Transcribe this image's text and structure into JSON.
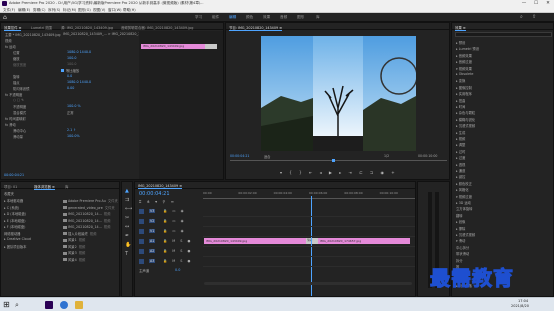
{
  "window": {
    "title": "Adobe Premiere Pro 2020 - D:\\用户\\5G\\学习资料\\最新版Premiere Pro 2020 从新手到高手 (微视频版) \\素材\\第4章\\...",
    "min": "—",
    "max": "☐",
    "close": "✕"
  },
  "menu": [
    "文件(F)",
    "编辑(E)",
    "剪辑(C)",
    "序列(S)",
    "标记(M)",
    "图形(G)",
    "视图(V)",
    "窗口(W)",
    "帮助(H)"
  ],
  "workspace_tabs": [
    {
      "label": "学习",
      "active": false
    },
    {
      "label": "组件",
      "active": false
    },
    {
      "label": "编辑",
      "active": true
    },
    {
      "label": "颜色",
      "active": false
    },
    {
      "label": "效果",
      "active": false
    },
    {
      "label": "音频",
      "active": false
    },
    {
      "label": "图形",
      "active": false
    },
    {
      "label": "库",
      "active": false
    }
  ],
  "effect_controls": {
    "tabs": [
      "效果控件 ≡",
      "Lumetri 范围",
      "源: IMG_20210820_143409.jpg",
      "音频剪辑混合器: IMG_20210820_143409.jpg"
    ],
    "source_label": "主要 * IMG_20210820_143409.jpg",
    "clip_label": "IMG_20210820_143409_... > IMG_20210820_143409.jpg",
    "section_video": "视频",
    "effect_motion": "fx 运动",
    "prop_position": "位置",
    "position_values": "1080.0  1440.0",
    "prop_scale": "缩放",
    "scale_value": "100.0",
    "prop_scale_width": "缩放宽度",
    "scale_width_value": "100.0",
    "uniform_scale": "等比缩放",
    "prop_rotation": "旋转",
    "rotation_value": "0.0",
    "prop_anchor": "锚点",
    "anchor_values": "1080.0  1440.0",
    "prop_flicker": "防闪烁滤镜",
    "flicker_value": "0.00",
    "effect_opacity": "fx 不透明度",
    "prop_opacity": "不透明度",
    "opacity_value": "100.0 %",
    "blend_mode": "混合模式",
    "blend_value": "正常",
    "effect_time": "fx 时间重映射",
    "effect_slide": "fx 滑动",
    "slide_center": "滑动中心",
    "slide_center_value": "2.1 ↑",
    "slide_amount": "滑动量",
    "slide_amount_value": "100.0%",
    "timecode": "00:00:04:21",
    "mini_clip": "IMG_20210820_143409.jpg"
  },
  "program_monitor": {
    "tab": "节目: IMG_20210820_143409 ≡",
    "timecode_left": "00:00:04:21",
    "fit": "适合",
    "fraction": "1/2",
    "timecode_right": "00:00:10:00"
  },
  "effects_panel": {
    "tab": "效果 ≡",
    "items": [
      "▸ 预设",
      "▸ Lumetri 预设",
      "▸ 音频效果",
      "▸ 音频过渡",
      "▾ 视频效果",
      "  ▸ Obsolete",
      "  ▸ 变换",
      "  ▸ 图像控制",
      "  ▸ 实用程序",
      "  ▸ 扭曲",
      "  ▸ 时间",
      "  ▸ 杂色与颗粒",
      "  ▸ 模糊与锐化",
      "  ▸ 沉浸式视频",
      "  ▸ 生成",
      "  ▸ 视频",
      "  ▸ 调整",
      "  ▸ 过时",
      "  ▸ 过渡",
      "  ▸ 透视",
      "  ▸ 通道",
      "  ▸ 键控",
      "  ▸ 颜色校正",
      "  ▸ 风格化",
      "▾ 视频过渡",
      "  ▸ 3D 运动",
      "    立方体旋转",
      "    翻转",
      "  ▸ 划像",
      "  ▸ 擦除",
      "  ▸ 沉浸式视频",
      "  ▾ 滑动",
      "    中心拆分",
      "    带状滑动",
      "    拆分",
      "    推",
      "    滑动",
      "  ▸ 缩放",
      "  ▸ 页面剥落"
    ]
  },
  "project_panel": {
    "tabs": [
      "项目: 01",
      "媒体浏览器 ≡",
      "库"
    ],
    "favorites": "收藏夹",
    "tree": [
      "▸ 本地驱动器",
      "  ▸ C (系统)",
      "  ▸ D (本地磁盘)",
      "  ▸ E (本地磁盘)",
      "  ▸ F (本地磁盘)",
      "网络驱动器",
      "▸ Creative Cloud",
      "  ▸ 团队项目版本"
    ],
    "files": [
      {
        "name": "Adobe Premiere Pro Au",
        "type": "文件夹"
      },
      {
        "name": "generated_video_pre",
        "type": "文件夹"
      },
      {
        "name": "IMG_20210820_14...",
        "type": "视频"
      },
      {
        "name": "IMG_20210820_14...",
        "type": "视频"
      },
      {
        "name": "IMG_20210820_14...",
        "type": "视频"
      },
      {
        "name": "插入片段最终",
        "type": "视频"
      },
      {
        "name": "风景1",
        "type": "视频"
      },
      {
        "name": "风景2",
        "type": "视频"
      },
      {
        "name": "风景3",
        "type": "视频"
      },
      {
        "name": "风景4",
        "type": "视频"
      }
    ]
  },
  "timeline": {
    "tab": "IMG_20210820_143409 ≡",
    "timecode": "00:00:04:21",
    "ruler": [
      "00:00",
      "00:00:02:00",
      "00:00:04:00",
      "00:00:06:00",
      "00:00:08:00",
      "00:00:10:00"
    ],
    "tracks": [
      {
        "name": "V3"
      },
      {
        "name": "V2"
      },
      {
        "name": "V1"
      },
      {
        "name": "A1"
      },
      {
        "name": "A2"
      },
      {
        "name": "A3"
      }
    ],
    "master": "主声道",
    "master_value": "0.0",
    "clip1": "IMG_20210820_143409.jpg",
    "clip2": "IMG_20210820_174657.jpg",
    "transition": "滑动"
  },
  "watermark": "最需教育",
  "taskbar": {
    "time": "17:04",
    "date": "2021/8/20",
    "search": "⌕"
  },
  "colors": {
    "accent": "#4ea4ff",
    "clip": "#e58ad9",
    "bg": "#232323"
  }
}
